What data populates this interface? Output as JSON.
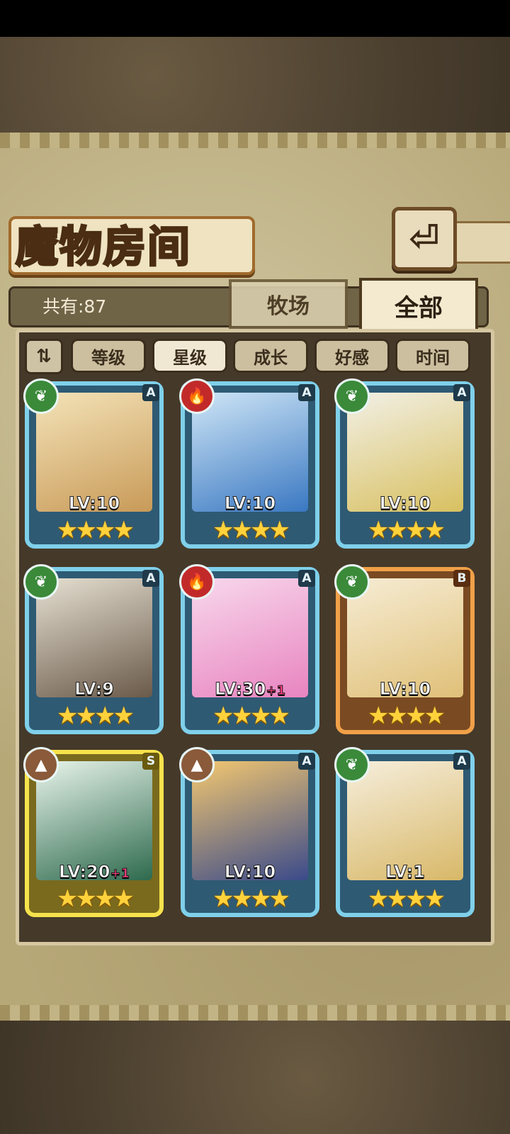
{
  "title": "魔物房间",
  "back_icon": "return-arrow-icon",
  "count_label": "共有:87",
  "tabs": [
    "牧场",
    "全部"
  ],
  "active_tab": "全部",
  "filters": [
    "等级",
    "星级",
    "成长",
    "好感",
    "时间"
  ],
  "active_filter": "星级",
  "sort_toggle_glyph": "⇅",
  "monsters": [
    {
      "element": "nature",
      "element_glyph": "❦",
      "rank": "A",
      "level": "LV:10",
      "bonus": "",
      "stars": 4,
      "frame": "blue"
    },
    {
      "element": "fire",
      "element_glyph": "🔥",
      "rank": "A",
      "level": "LV:10",
      "bonus": "",
      "stars": 4,
      "frame": "blue"
    },
    {
      "element": "nature",
      "element_glyph": "❦",
      "rank": "A",
      "level": "LV:10",
      "bonus": "",
      "stars": 4,
      "frame": "blue"
    },
    {
      "element": "nature",
      "element_glyph": "❦",
      "rank": "A",
      "level": "LV:9",
      "bonus": "",
      "stars": 4,
      "frame": "blue"
    },
    {
      "element": "fire",
      "element_glyph": "🔥",
      "rank": "A",
      "level": "LV:30",
      "bonus": "+1",
      "stars": 4,
      "frame": "blue"
    },
    {
      "element": "nature",
      "element_glyph": "❦",
      "rank": "B",
      "level": "LV:10",
      "bonus": "",
      "stars": 4,
      "frame": "orange"
    },
    {
      "element": "earth",
      "element_glyph": "▲",
      "rank": "S",
      "level": "LV:20",
      "bonus": "+1",
      "stars": 4,
      "frame": "gold"
    },
    {
      "element": "earth",
      "element_glyph": "▲",
      "rank": "A",
      "level": "LV:10",
      "bonus": "",
      "stars": 4,
      "frame": "blue"
    },
    {
      "element": "nature",
      "element_glyph": "❦",
      "rank": "A",
      "level": "LV:1",
      "bonus": "",
      "stars": 4,
      "frame": "blue"
    }
  ],
  "colors": {
    "frame_blue": "#7fd0ea",
    "frame_orange": "#f0a048",
    "frame_gold": "#f6e24c",
    "nature": "#3a8a3a",
    "fire": "#c22a2a",
    "earth": "#8a5a3a"
  }
}
